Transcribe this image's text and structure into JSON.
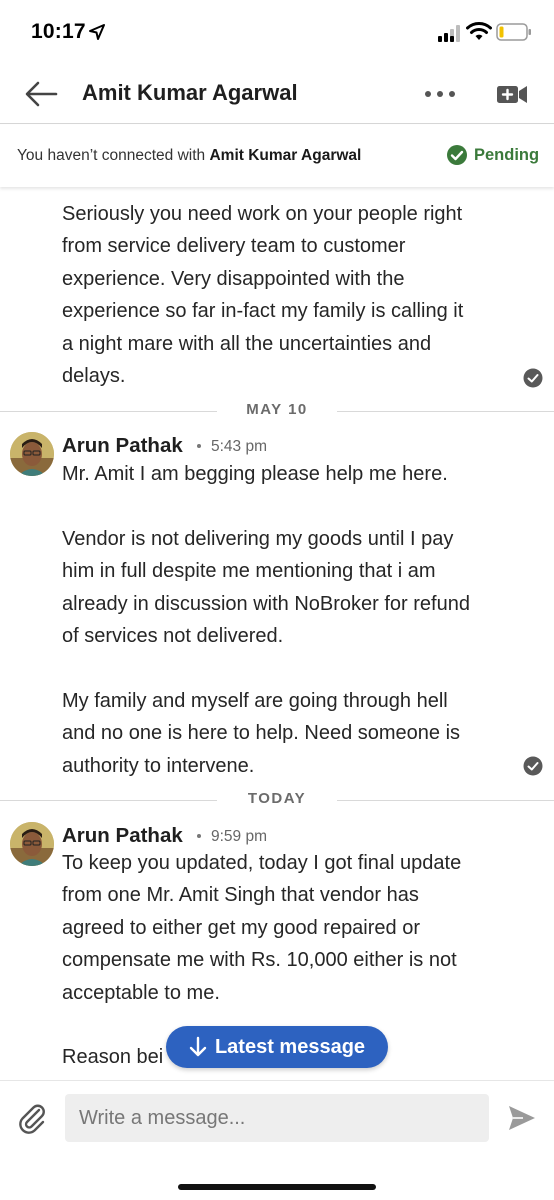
{
  "status_bar": {
    "time": "10:17",
    "icons": [
      "location-arrow-icon",
      "cellular-signal-icon",
      "wifi-icon",
      "battery-icon"
    ]
  },
  "header": {
    "title": "Amit Kumar Agarwal",
    "icons": [
      "back-arrow-icon",
      "more-options-icon",
      "video-call-icon"
    ]
  },
  "connection_banner": {
    "text_prefix": "You haven’t connected with ",
    "name": "Amit Kumar Agarwal",
    "status": "Pending",
    "status_color": "#3b7a3b"
  },
  "conversation": {
    "first_message": {
      "lines": [
        "Seriously you need work on your people right",
        "from service delivery team to customer",
        "experience. Very disappointed with the",
        "experience so far in-fact my family is calling it",
        "a night mare with all the uncertainties and",
        "delays."
      ]
    },
    "groups": [
      {
        "date": "MAY 10",
        "sender": "Arun Pathak",
        "time": "5:43 pm",
        "lines": [
          "Mr. Amit I am begging please help me here.",
          "",
          "Vendor is not delivering my goods until I pay",
          "him in full despite me mentioning that i am",
          "already in discussion with NoBroker for refund",
          "of services not delivered.",
          "",
          "My family and myself are going through hell",
          "and no one is here to help. Need someone is",
          "authority to intervene."
        ]
      },
      {
        "date": "TODAY",
        "sender": "Arun Pathak",
        "time": "9:59 pm",
        "lines": [
          "To keep you updated, today I got final update",
          "from one Mr. Amit Singh that vendor has",
          "agreed to either get my good repaired or",
          "compensate me with Rs. 10,000 either is not",
          "acceptable to me.",
          "",
          "Reason bei"
        ]
      }
    ]
  },
  "latest_message_button": {
    "label": "Latest message",
    "color": "#2d62c0"
  },
  "composer": {
    "placeholder": "Write a message..."
  }
}
